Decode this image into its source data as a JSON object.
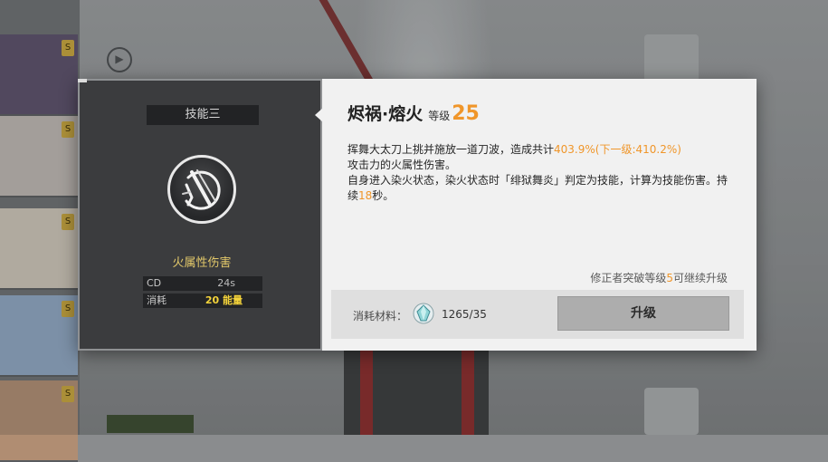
{
  "background": {
    "top_option_label": "",
    "party_button_label": "",
    "right_items": [
      "",
      "",
      ""
    ]
  },
  "skill": {
    "index_label": "技能三",
    "name": "烬祸·熔火",
    "level_label": "等级",
    "level": "25",
    "element": "火属性伤害",
    "icon": "slash-skill-icon"
  },
  "stats": {
    "cd_label": "CD",
    "cd_value": "24s",
    "cost_label": "消耗",
    "cost_value": "20 能量"
  },
  "description": {
    "line1_pre": "挥舞大太刀上挑并施放一道刀波，造成共计",
    "line1_value": "403.9%(下一级:410.2%)",
    "line1_post": "攻击力的火属性伤害。",
    "line2_pre": "自身进入染火状态，染火状态时「绯狱舞炎」判定为技能，计算为技能伤害。持续",
    "line2_value": "18",
    "line2_post": "秒。"
  },
  "upgrade_hint": {
    "pre": "修正者突破等级",
    "value": "5",
    "post": "可继续升级"
  },
  "cost": {
    "label": "消耗材料：",
    "material_icon": "crystal-material-icon",
    "amount": "1265/35"
  },
  "upgrade_button_label": "升级",
  "colors": {
    "accent_orange": "#f0962a",
    "energy_yellow": "#f4d33a",
    "element_gold": "#e2c86a",
    "panel_dark": "#3b3c3e",
    "panel_light": "#f1f1f1"
  }
}
